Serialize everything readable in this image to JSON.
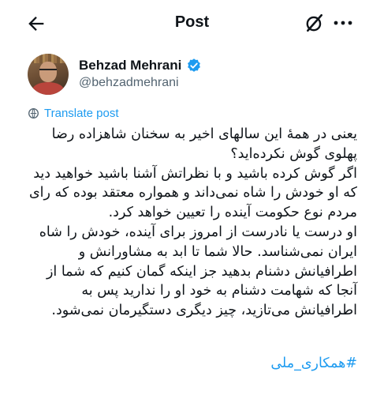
{
  "header": {
    "title": "Post"
  },
  "author": {
    "name": "Behzad Mehrani",
    "handle": "@behzadmehrani"
  },
  "translate_label": "Translate post",
  "post": {
    "lines": [
      "یعنی در همهٔ این سالهای اخیر به سخنان شاهزاده رضا",
      "پهلوی گوش نکرده‌اید؟",
      "اگر گوش کرده باشید و با نظراتش آشنا باشید خواهید دید",
      "که او خودش را شاه نمی‌داند و همواره معتقد بوده که رای",
      "مردم نوع حکومت آینده را تعیین خواهد کرد.",
      "او درست یا نادرست از امروز برای آینده، خودش را شاه",
      "ایران نمی‌شناسد. حالا شما تا ابد به مشاورانش و",
      "اطرافیانش دشنام بدهید جز اینکه گمان کنیم که شما از",
      "آنجا که شهامت دشنام به خود او را ندارید پس به",
      "اطرافیانش می‌تازید، چیز دیگری دستگیرمان نمی‌شود."
    ],
    "hashtag": "#همکاری_ملی"
  },
  "icons": {
    "back": "arrow-left-icon",
    "grok": "grok-icon",
    "more": "more-horizontal-icon",
    "verified": "verified-badge-icon",
    "translate": "globe-translate-icon"
  },
  "colors": {
    "accent": "#1d9bf0",
    "secondary_text": "#536471",
    "text": "#0f1419"
  }
}
